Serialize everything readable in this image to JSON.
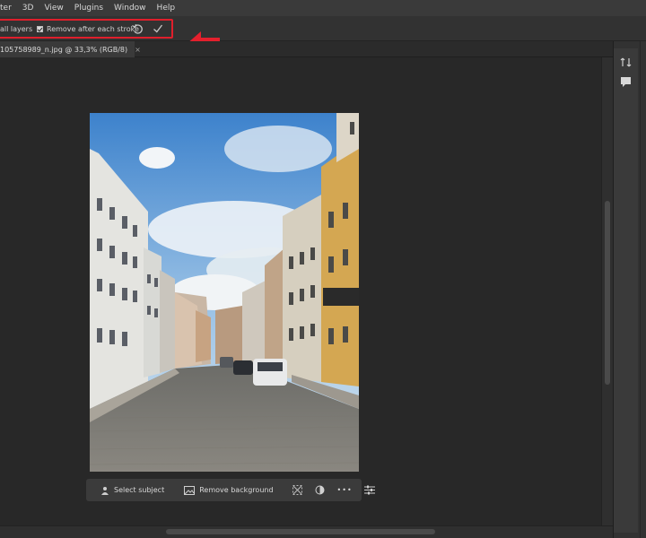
{
  "menu": [
    "ter",
    "3D",
    "View",
    "Plugins",
    "Window",
    "Help"
  ],
  "options": {
    "sample_all_layers": "all layers",
    "remove_after_stroke": "Remove after each stroke"
  },
  "document_tab": {
    "title": "105758989_n.jpg @ 33,3% (RGB/8)",
    "close": "×"
  },
  "taskbar": {
    "select_subject": "Select subject",
    "remove_background": "Remove background",
    "more": "•••"
  },
  "colors": {
    "highlight": "#e01f2c",
    "arrow": "#e4202d"
  },
  "icons": [
    "reset-icon",
    "commit-check-icon",
    "transform-icon",
    "adjust-icon",
    "settings-sliders-icon",
    "history-icon",
    "comment-icon"
  ]
}
